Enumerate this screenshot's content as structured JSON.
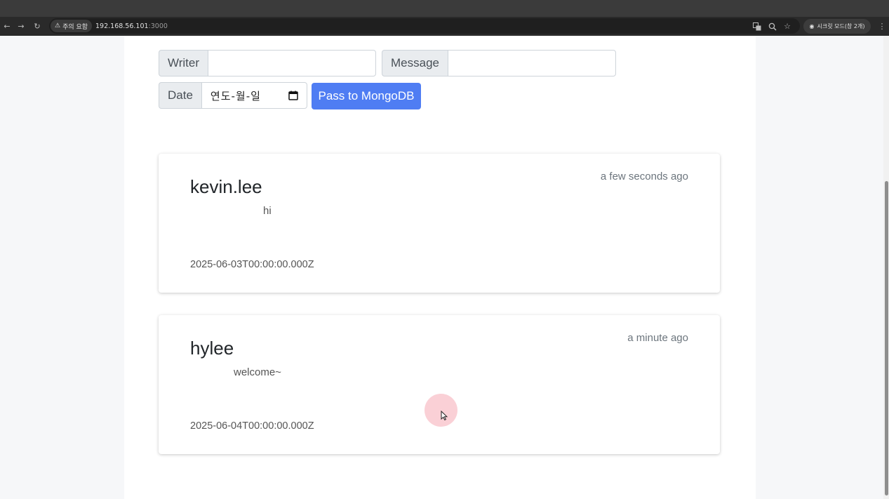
{
  "browser": {
    "security_label": "주의 요함",
    "url_host": "192.168.56.101",
    "url_port": ":3000",
    "incognito_label": "시크릿 모드(창 2개)"
  },
  "form": {
    "writer_label": "Writer",
    "writer_value": "",
    "message_label": "Message",
    "message_value": "",
    "date_label": "Date",
    "date_placeholder": "연도-월-일",
    "submit_label": "Pass to MongoDB"
  },
  "posts": [
    {
      "writer": "kevin.lee",
      "time": "a few seconds ago",
      "message": "hi",
      "date": "2025-06-03T00:00:00.000Z"
    },
    {
      "writer": "hylee",
      "time": "a minute ago",
      "message": "welcome~",
      "date": "2025-06-04T00:00:00.000Z"
    }
  ],
  "colors": {
    "primary": "#4f7df3",
    "cursor_halo": "#f6aab4"
  }
}
